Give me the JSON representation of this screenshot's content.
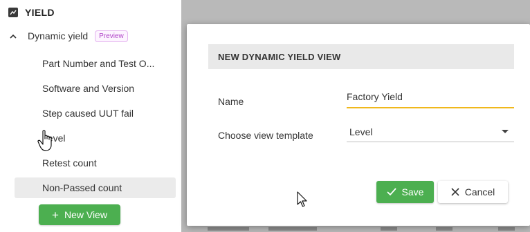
{
  "sidebar": {
    "section_title": "YIELD",
    "section_icon": "yield-chart-icon",
    "group": {
      "label": "Dynamic yield",
      "badge": "Preview",
      "expand_icon": "chevron-up-icon"
    },
    "items": [
      {
        "label": "Part Number and Test O..."
      },
      {
        "label": "Software and Version"
      },
      {
        "label": "Step caused UUT fail"
      },
      {
        "label": "Level"
      },
      {
        "label": "Retest count"
      },
      {
        "label": "Non-Passed count"
      }
    ],
    "active_item": "Non-Passed count",
    "new_view_label": "New View"
  },
  "modal": {
    "title": "NEW DYNAMIC YIELD VIEW",
    "name_label": "Name",
    "name_value": "Factory Yield",
    "template_label": "Choose view template",
    "template_value": "Level",
    "save_label": "Save",
    "cancel_label": "Cancel"
  },
  "colors": {
    "accent_green": "#4caf50",
    "input_focus": "#f0b81c",
    "badge": "#b044c8",
    "active_item_bg": "#ebebeb"
  }
}
